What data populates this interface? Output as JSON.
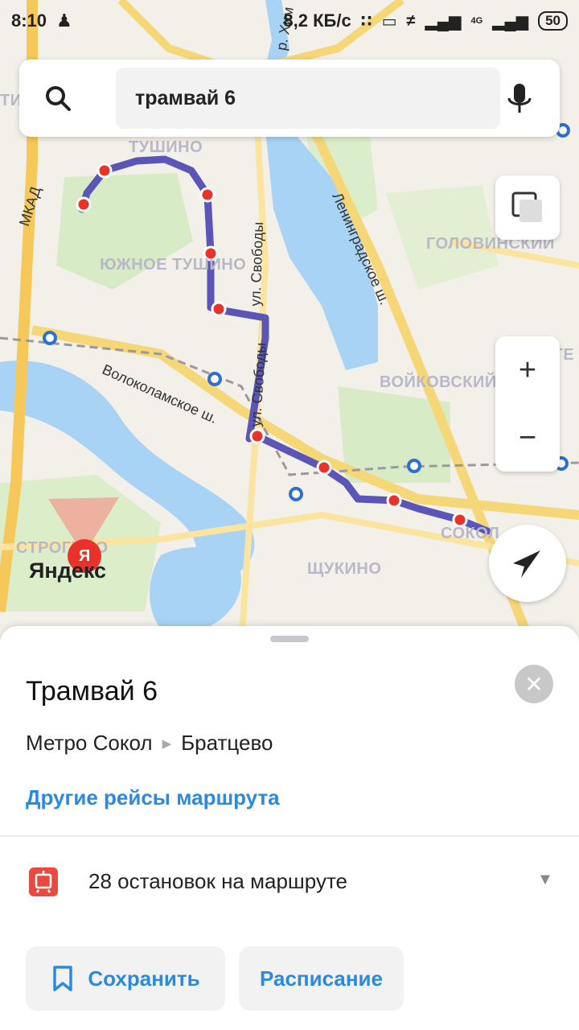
{
  "status_bar": {
    "time": "8:10",
    "network_speed": "8,2 КБ/с",
    "network_type": "4G",
    "battery": "50",
    "icons": [
      "person-icon",
      "bluetooth-icon",
      "toggle-icon",
      "bell-off-icon",
      "signal-icon",
      "signal-icon"
    ]
  },
  "search": {
    "query": "трамвай 6"
  },
  "map": {
    "district_labels": {
      "tushino": "ТУШИНО",
      "south_tushino": "ЮЖНОЕ ТУШИНО",
      "golovinsky": "ГОЛОВИНСКИЙ",
      "voykovsky": "ВОЙКОВСКИЙ",
      "koptevo": "КОПТЕ",
      "schukino": "ЩУКИНО",
      "sokol": "СОКОЛ",
      "strogino": "СТРОГИНО",
      "left_edge": "ТИ"
    },
    "street_labels": {
      "mkad": "МКАД",
      "leningradskoe": "Ленинградское ш.",
      "svobody_1": "ул. Свободы",
      "svobody_2": "ул. Свободы",
      "volokolamskoe": "Волоколамское ш.",
      "r_khim": "р. Хим"
    },
    "route_color": "#5b55b8",
    "stop_color": "#e8322a",
    "logo": "Яндекс"
  },
  "sheet": {
    "title": "Трамвай 6",
    "route_from": "Метро Сокол",
    "route_to": "Братцево",
    "other_trips_link": "Другие рейсы маршрута",
    "stops_summary": "28 остановок на маршруте",
    "save_label": "Сохранить",
    "schedule_label": "Расписание",
    "accent_color": "#2b8ae0"
  }
}
